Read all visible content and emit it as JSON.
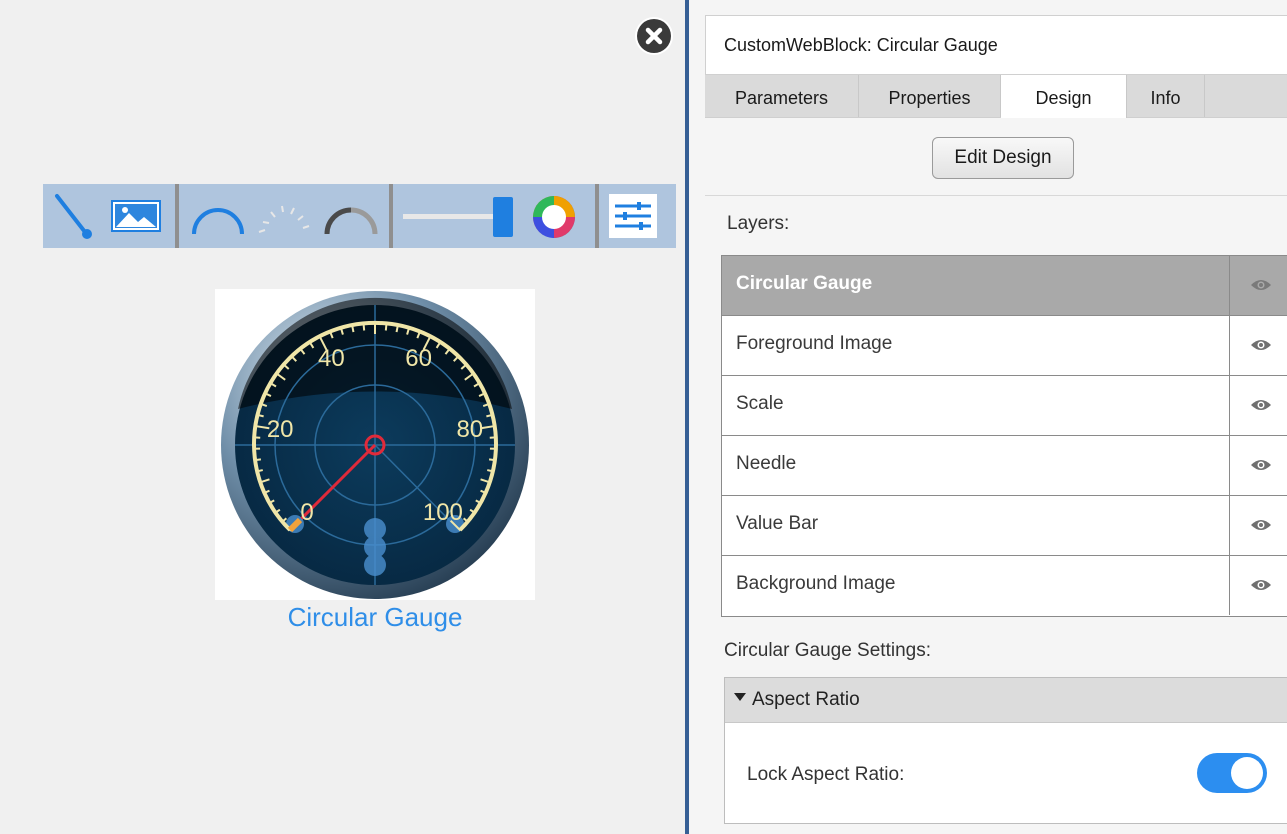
{
  "canvas": {
    "close_icon": "close-circle-icon",
    "toolbar": {
      "tools": [
        {
          "name": "needle-icon"
        },
        {
          "name": "image-icon"
        },
        {
          "name": "arc-scale-icon"
        },
        {
          "name": "tick-scale-icon"
        },
        {
          "name": "value-bar-arc-icon"
        },
        {
          "name": "slider-icon"
        },
        {
          "name": "color-wheel-icon"
        },
        {
          "name": "settings-sliders-icon"
        }
      ]
    },
    "gauge": {
      "ticks": [
        "0",
        "20",
        "40",
        "60",
        "80",
        "100"
      ],
      "value": 0,
      "needle_color": "#e02a3a"
    },
    "block_label": "Circular Gauge"
  },
  "panel": {
    "title": "CustomWebBlock: Circular Gauge",
    "tabs": [
      {
        "label": "Parameters"
      },
      {
        "label": "Properties"
      },
      {
        "label": "Design"
      },
      {
        "label": "Info"
      }
    ],
    "active_tab": "Design",
    "edit_design_label": "Edit Design",
    "layers_label": "Layers:",
    "layers": [
      {
        "name": "Circular Gauge",
        "selected": true
      },
      {
        "name": "Foreground Image"
      },
      {
        "name": "Scale"
      },
      {
        "name": "Needle"
      },
      {
        "name": "Value Bar"
      },
      {
        "name": "Background Image"
      }
    ],
    "settings_label": "Circular Gauge Settings:",
    "aspect_section": "Aspect Ratio",
    "lock_aspect_label": "Lock Aspect Ratio:",
    "lock_aspect_value": true,
    "accent_color": "#2c8ef0"
  }
}
